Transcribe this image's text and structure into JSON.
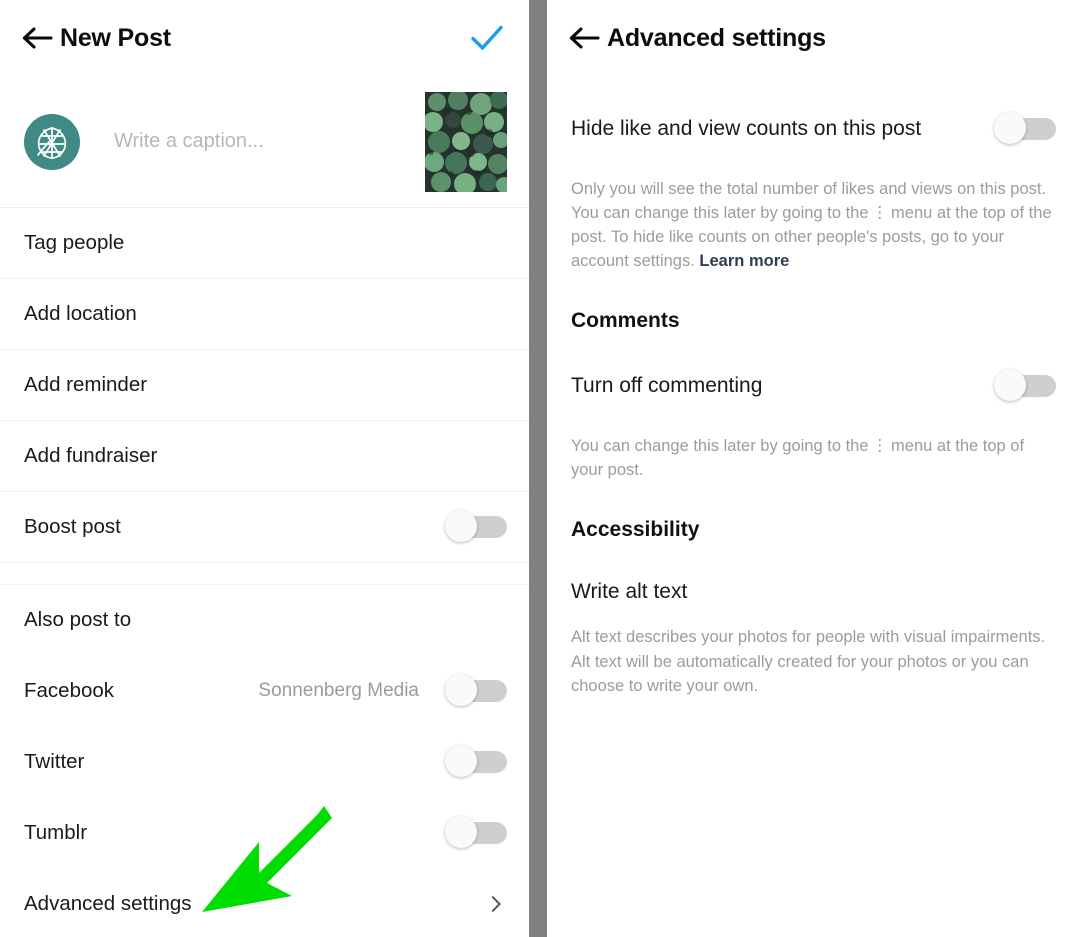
{
  "colors": {
    "accent_check": "#1f9bf0",
    "avatar_bg": "#3f8a85",
    "annotation_green": "#00dd00",
    "link": "#2e4054",
    "divider_gray": "#808080",
    "toggle_track_off": "#cfcfcf",
    "muted_text": "#9c9c9c"
  },
  "left_panel": {
    "header": {
      "back_icon": "arrow-left-icon",
      "title": "New Post",
      "confirm_icon": "check-icon"
    },
    "composer": {
      "avatar_icon": "leaf-logo-avatar",
      "caption_placeholder": "Write a caption...",
      "caption_value": "",
      "thumbnail_icon": "succulent-photo-thumbnail"
    },
    "rows": [
      {
        "label": "Tag people",
        "control": "none"
      },
      {
        "label": "Add location",
        "control": "none"
      },
      {
        "label": "Add reminder",
        "control": "none"
      },
      {
        "label": "Add fundraiser",
        "control": "none"
      },
      {
        "label": "Boost post",
        "control": "toggle",
        "toggle_on": false
      }
    ],
    "also_post_to": {
      "heading": "Also post to",
      "items": [
        {
          "label": "Facebook",
          "value": "Sonnenberg Media",
          "toggle_on": false
        },
        {
          "label": "Twitter",
          "value": "",
          "toggle_on": false
        },
        {
          "label": "Tumblr",
          "value": "",
          "toggle_on": false
        }
      ]
    },
    "advanced_settings": {
      "label": "Advanced settings",
      "chevron_icon": "chevron-right-icon"
    }
  },
  "right_panel": {
    "header": {
      "back_icon": "arrow-left-icon",
      "title": "Advanced settings"
    },
    "hide_counts": {
      "label": "Hide like and view counts on this post",
      "toggle_on": false,
      "help_part1": "Only you will see the total number of likes and views on this post. You can change this later by going to the",
      "help_kebab": "⋮",
      "help_part2": "menu at the top of the post. To hide like counts on other people's posts, go to your account settings.",
      "link_label": "Learn more"
    },
    "comments": {
      "section_title": "Comments",
      "label": "Turn off commenting",
      "toggle_on": false,
      "help_part1": "You can change this later by going to the",
      "help_kebab": "⋮",
      "help_part2": "menu at the top of your post."
    },
    "accessibility": {
      "section_title": "Accessibility",
      "action_label": "Write alt text",
      "help": "Alt text describes your photos for people with visual impairments. Alt text will be automatically created for your photos or you can choose to write your own."
    }
  },
  "annotations": [
    {
      "name": "arrow-pointing-to-advanced-settings",
      "direction": "down-left"
    },
    {
      "name": "arrow-pointing-to-write-alt-text",
      "direction": "down-left"
    }
  ]
}
